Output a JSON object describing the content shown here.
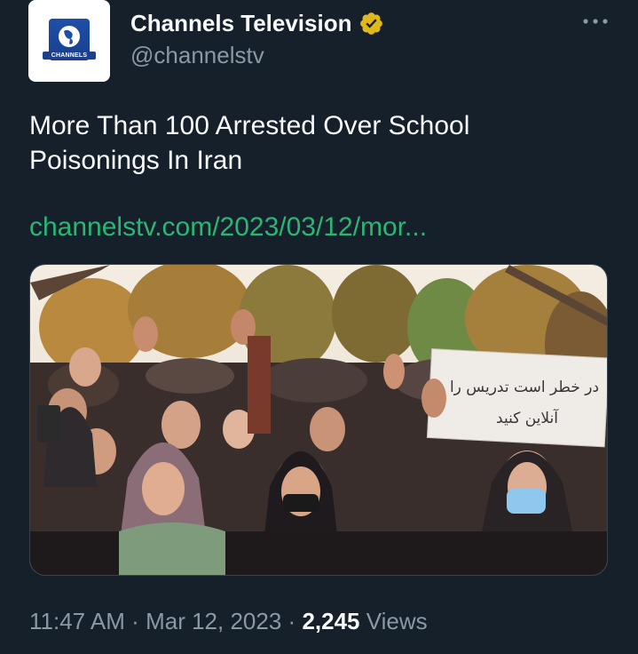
{
  "author": {
    "display_name": "Channels Television",
    "handle": "@channelstv",
    "avatar_logo_text": "CHANNELS",
    "verified_badge": "verified-gold-icon"
  },
  "menu": {
    "icon": "more-horizontal-icon"
  },
  "tweet": {
    "text": "More Than 100 Arrested Over School Poisonings In Iran",
    "link": "channelstv.com/2023/03/12/mor..."
  },
  "media": {
    "sign_line_1": "در خطر است تدریس را",
    "sign_line_2": "آنلاین کنید"
  },
  "meta": {
    "time": "11:47 AM",
    "separator": "·",
    "date": "Mar 12, 2023",
    "views_count": "2,245",
    "views_label": "Views"
  },
  "colors": {
    "background": "#15202b",
    "link": "#2bb673",
    "secondary_text": "#8b98a5",
    "verified": "#e2b719"
  }
}
